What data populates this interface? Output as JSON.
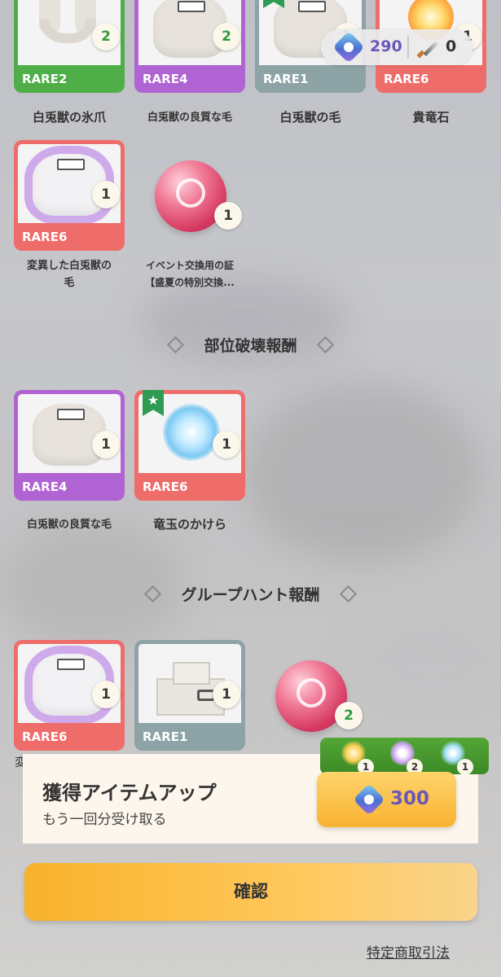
{
  "currency": {
    "gems": "290",
    "knives": "0",
    "gem_icon": "paw-gem-icon",
    "knife_icon": "knife-icon"
  },
  "rewards_top": [
    {
      "rare": "RARE2",
      "count": "2",
      "name": "白兎獣の氷爪"
    },
    {
      "rare": "RARE4",
      "count": "2",
      "name": "白兎獣の良質な毛"
    },
    {
      "rare": "RARE1",
      "count": "1",
      "name": "白兎獣の毛"
    },
    {
      "rare": "RARE6",
      "count": "1",
      "name": "貴竜石"
    },
    {
      "rare": "RARE6",
      "count": "1",
      "name_line1": "変異した白兎獣の",
      "name_line2": "毛"
    },
    {
      "count": "1",
      "name_line1": "イベント交換用の証",
      "name_line2": "【盛夏の特別交換..."
    }
  ],
  "part_break": {
    "title": "部位破壊報酬",
    "items": [
      {
        "rare": "RARE4",
        "count": "1",
        "name": "白兎獣の良質な毛"
      },
      {
        "rare": "RARE6",
        "count": "1",
        "name": "竜玉のかけら"
      }
    ]
  },
  "group_hunt": {
    "title": "グループハント報酬",
    "items": [
      {
        "rare": "RARE6",
        "count": "1",
        "cut_name": "変"
      },
      {
        "rare": "RARE1",
        "count": "1"
      },
      {
        "count": "2"
      }
    ]
  },
  "bonus": {
    "title": "獲得アイテムアップ",
    "subtitle": "もう一回分受け取る",
    "preview_counts": [
      "1",
      "2",
      "1"
    ],
    "price": "300"
  },
  "confirm_label": "確認",
  "legal_link": "特定商取引法",
  "colors": {
    "rare1": "#8da3a6",
    "rare2": "#4fae48",
    "rare4": "#b063d3",
    "rare6": "#ee6d6b",
    "confirm": "#f8b22a"
  }
}
